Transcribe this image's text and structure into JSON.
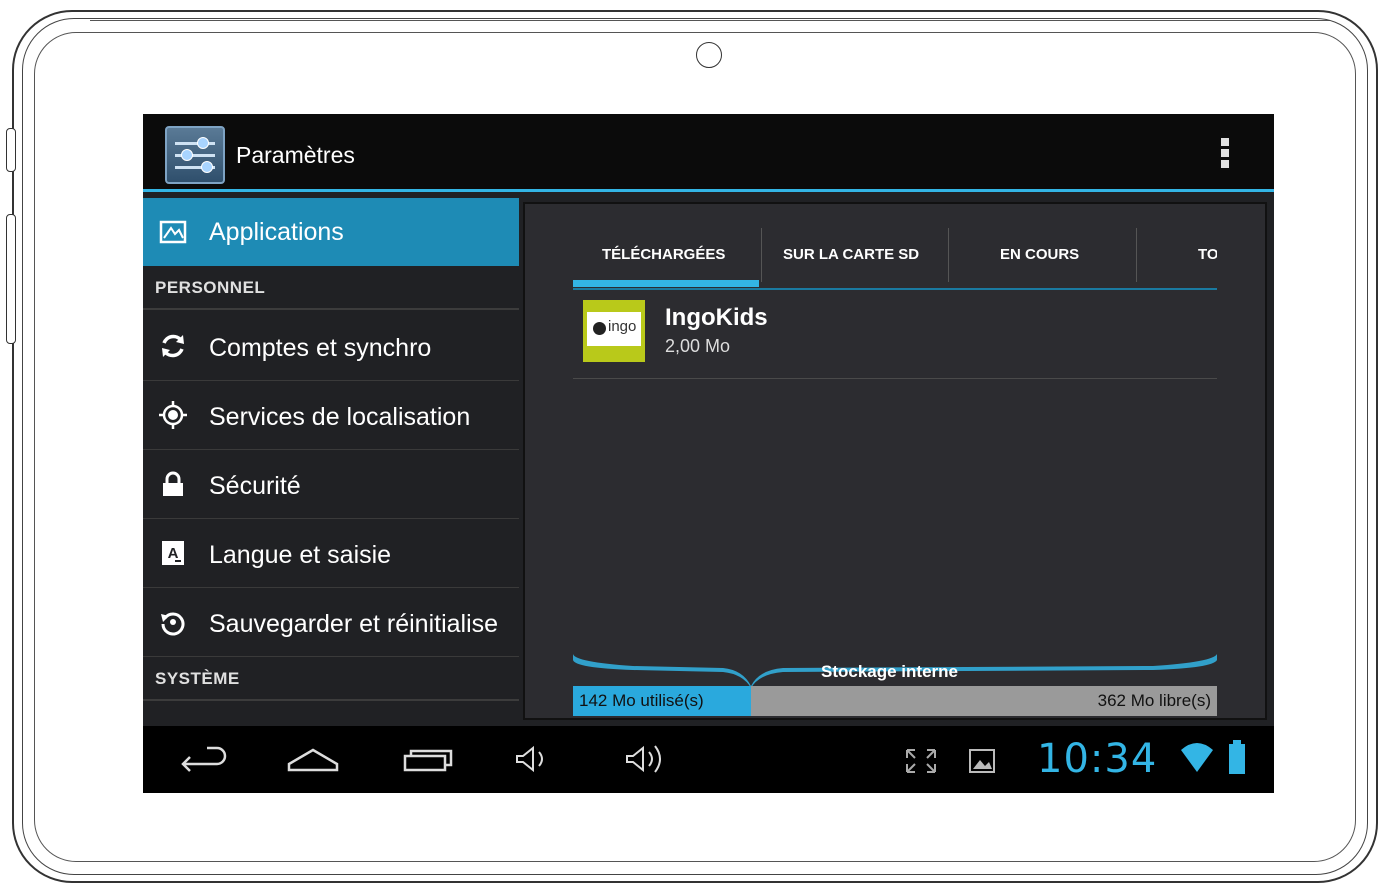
{
  "action_bar": {
    "title": "Paramètres",
    "settings_icon": "settings-sliders-icon",
    "overflow_icon": "overflow-menu-icon"
  },
  "sidebar": {
    "selected": {
      "label": "Applications",
      "icon": "applications-icon"
    },
    "section_personal": "PERSONNEL",
    "items": [
      {
        "label": "Comptes et synchro",
        "icon": "sync-icon"
      },
      {
        "label": "Services de localisation",
        "icon": "location-icon"
      },
      {
        "label": "Sécurité",
        "icon": "lock-icon"
      },
      {
        "label": "Langue et saisie",
        "icon": "language-icon"
      },
      {
        "label": "Sauvegarder et réinitialise",
        "icon": "backup-icon"
      }
    ],
    "section_system": "SYSTÈME"
  },
  "tabs": [
    "TÉLÉCHARGÉES",
    "SUR LA CARTE SD",
    "EN COURS",
    "TO"
  ],
  "app_list": [
    {
      "name": "IngoKids",
      "size": "2,00 Mo",
      "logo_text": "ingo"
    }
  ],
  "storage": {
    "label": "Stockage interne",
    "used": "142 Mo utilisé(s)",
    "free": "362 Mo libre(s)"
  },
  "status_bar": {
    "time": "10:34",
    "nav_icons": [
      "back-icon",
      "home-icon",
      "recent-apps-icon",
      "volume-down-icon",
      "volume-up-icon"
    ],
    "status_icons": [
      "fullscreen-icon",
      "screenshot-icon",
      "wifi-icon",
      "battery-icon"
    ]
  },
  "colors": {
    "accent": "#33b5e5",
    "selected": "#1e8bb5",
    "logo": "#b9c91a"
  }
}
